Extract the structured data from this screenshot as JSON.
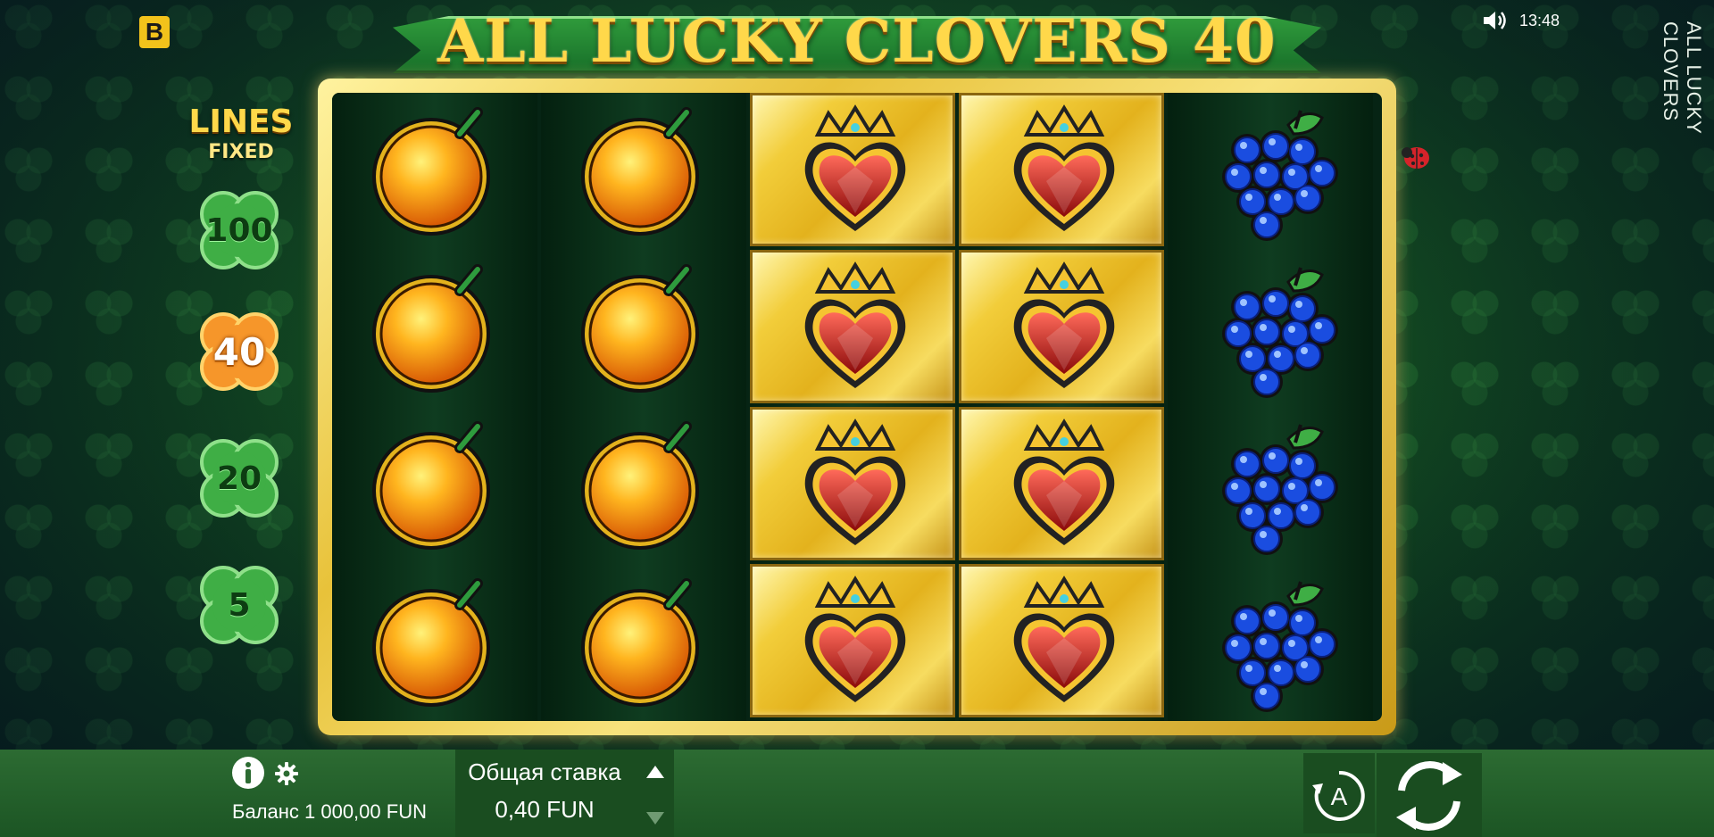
{
  "brand": {
    "badge_label": "B"
  },
  "title": {
    "text": "ALL LUCKY CLOVERS 40",
    "side_label": "ALL LUCKY CLOVERS"
  },
  "status": {
    "time": "13:48",
    "sound_icon": "speaker-icon"
  },
  "lines_panel": {
    "title": "LINES",
    "subtitle": "FIXED",
    "options": [
      {
        "label": "100",
        "active": false
      },
      {
        "label": "40",
        "active": true
      },
      {
        "label": "20",
        "active": false
      },
      {
        "label": "5",
        "active": false
      }
    ]
  },
  "reels": {
    "columns": 5,
    "rows": 4,
    "grid": [
      [
        "orange",
        "orange",
        "crowned-heart",
        "crowned-heart",
        "grapes"
      ],
      [
        "orange",
        "orange",
        "crowned-heart",
        "crowned-heart",
        "grapes"
      ],
      [
        "orange",
        "orange",
        "crowned-heart",
        "crowned-heart",
        "grapes"
      ],
      [
        "orange",
        "orange",
        "crowned-heart",
        "crowned-heart",
        "grapes"
      ]
    ],
    "highlighted_columns": [
      2,
      3
    ]
  },
  "footer": {
    "info_icon": "info-icon",
    "settings_icon": "gear-icon",
    "balance_text": "Баланс 1 000,00 FUN",
    "bet_label": "Общая ставка",
    "bet_value": "0,40 FUN",
    "auto_label": "A",
    "spin_icon": "spin-icon"
  },
  "colors": {
    "gold": "#f2cd3a",
    "green_bar": "#2c6b32",
    "title_gold": "#ffd84a",
    "active_line": "#f6962a"
  }
}
